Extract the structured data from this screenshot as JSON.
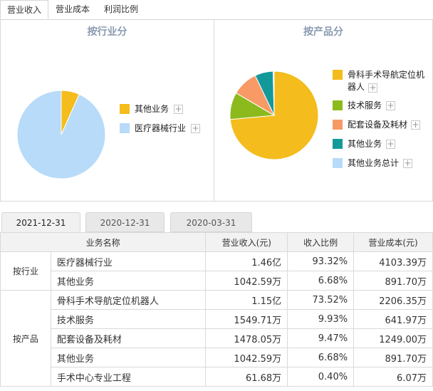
{
  "tabs": [
    "营业收入",
    "营业成本",
    "利润比例"
  ],
  "panels": {
    "industry": {
      "title": "按行业分",
      "legend": [
        {
          "label": "其他业务",
          "color": "#f4bc1c",
          "value": 6.68
        },
        {
          "label": "医疗器械行业",
          "color": "#b7dbf9",
          "value": 93.32
        }
      ]
    },
    "product": {
      "title": "按产品分",
      "legend": [
        {
          "label": "骨科手术导航定位机器人",
          "color": "#f4bc1c",
          "value": 73.52
        },
        {
          "label": "技术服务",
          "color": "#8cba1d",
          "value": 9.93
        },
        {
          "label": "配套设备及耗材",
          "color": "#f79a66",
          "value": 9.47
        },
        {
          "label": "其他业务",
          "color": "#14999a",
          "value": 6.68
        },
        {
          "label": "其他业务总计",
          "color": "#b7dbf9",
          "value": 0.4
        }
      ]
    }
  },
  "date_tabs": [
    "2021-12-31",
    "2020-12-31",
    "2020-03-31"
  ],
  "table": {
    "headers": [
      "业务名称",
      "营业收入(元)",
      "收入比例",
      "营业成本(元)"
    ],
    "groups": [
      {
        "label": "按行业",
        "rows": [
          {
            "name": "医疗器械行业",
            "revenue": "1.46亿",
            "ratio": "93.32%",
            "cost": "4103.39万"
          },
          {
            "name": "其他业务",
            "revenue": "1042.59万",
            "ratio": "6.68%",
            "cost": "891.70万"
          }
        ]
      },
      {
        "label": "按产品",
        "rows": [
          {
            "name": "骨科手术导航定位机器人",
            "revenue": "1.15亿",
            "ratio": "73.52%",
            "cost": "2206.35万"
          },
          {
            "name": "技术服务",
            "revenue": "1549.71万",
            "ratio": "9.93%",
            "cost": "641.97万"
          },
          {
            "name": "配套设备及耗材",
            "revenue": "1478.05万",
            "ratio": "9.47%",
            "cost": "1249.00万"
          },
          {
            "name": "其他业务",
            "revenue": "1042.59万",
            "ratio": "6.68%",
            "cost": "891.70万"
          },
          {
            "name": "手术中心专业工程",
            "revenue": "61.68万",
            "ratio": "0.40%",
            "cost": "6.07万"
          }
        ]
      }
    ]
  }
}
